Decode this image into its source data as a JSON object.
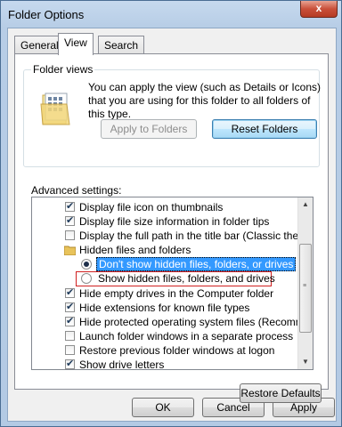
{
  "window": {
    "title": "Folder Options",
    "close_label": "x"
  },
  "tabs": [
    {
      "label": "General",
      "active": false
    },
    {
      "label": "View",
      "active": true
    },
    {
      "label": "Search",
      "active": false
    }
  ],
  "folder_views": {
    "legend": "Folder views",
    "description": "You can apply the view (such as Details or Icons) that you are using for this folder to all folders of this type.",
    "apply_button": "Apply to Folders",
    "reset_button": "Reset Folders"
  },
  "advanced": {
    "label": "Advanced settings:",
    "items": [
      {
        "type": "checkbox",
        "checked": true,
        "label": "Display file icon on thumbnails"
      },
      {
        "type": "checkbox",
        "checked": true,
        "label": "Display file size information in folder tips"
      },
      {
        "type": "checkbox",
        "checked": false,
        "label": "Display the full path in the title bar (Classic theme only)"
      },
      {
        "type": "folder",
        "label": "Hidden files and folders"
      },
      {
        "type": "radio",
        "checked": true,
        "label": "Don't show hidden files, folders, or drives",
        "selected": true
      },
      {
        "type": "radio",
        "checked": false,
        "label": "Show hidden files, folders, and drives",
        "highlighted": true
      },
      {
        "type": "checkbox",
        "checked": true,
        "label": "Hide empty drives in the Computer folder"
      },
      {
        "type": "checkbox",
        "checked": true,
        "label": "Hide extensions for known file types"
      },
      {
        "type": "checkbox",
        "checked": true,
        "label": "Hide protected operating system files (Recommended)"
      },
      {
        "type": "checkbox",
        "checked": false,
        "label": "Launch folder windows in a separate process"
      },
      {
        "type": "checkbox",
        "checked": false,
        "label": "Restore previous folder windows at logon"
      },
      {
        "type": "checkbox",
        "checked": true,
        "label": "Show drive letters"
      }
    ],
    "restore_button": "Restore Defaults"
  },
  "footer": {
    "ok": "OK",
    "cancel": "Cancel",
    "apply": "Apply"
  },
  "colors": {
    "selection": "#3399ff",
    "highlight_border": "#d02020",
    "title_gradient": "#b7cde6"
  }
}
